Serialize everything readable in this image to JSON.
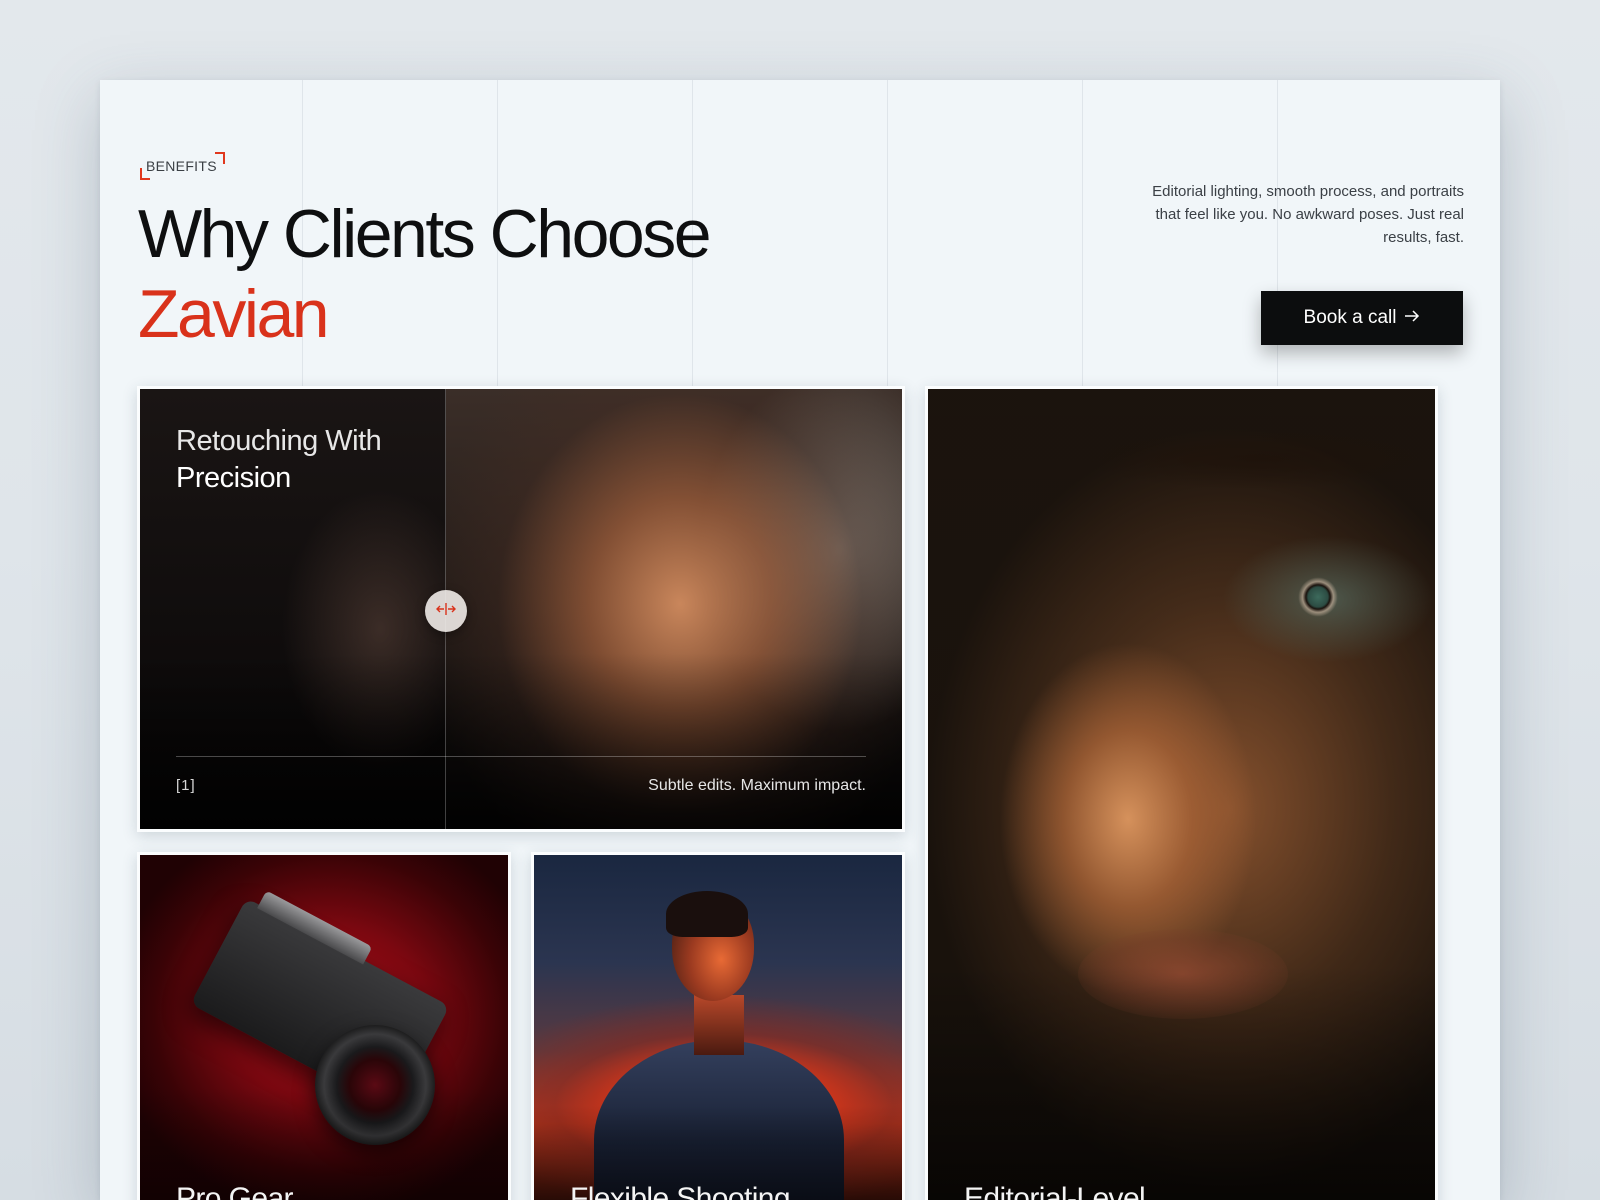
{
  "header": {
    "eyebrow": "BENEFITS",
    "title_line1": "Why Clients Choose",
    "title_line2": "Zavian",
    "intro": "Editorial lighting, smooth process, and portraits that feel like you. No awkward poses. Just real results, fast.",
    "cta_label": "Book a call",
    "cta_icon": "arrow-right-icon"
  },
  "colors": {
    "accent": "#d9321b",
    "background": "#f1f6f9",
    "cta_background": "#0c0d0e"
  },
  "cards": {
    "retouch": {
      "title_line1": "Retouching With",
      "title_line2": "Precision",
      "index": "[1]",
      "caption": "Subtle edits. Maximum impact.",
      "handle_icon": "compare-arrows-icon"
    },
    "pro_gear": {
      "label": "Pro Gear"
    },
    "flexible_shooting": {
      "label": "Flexible Shooting"
    },
    "editorial": {
      "label": "Editorial-Level"
    }
  }
}
